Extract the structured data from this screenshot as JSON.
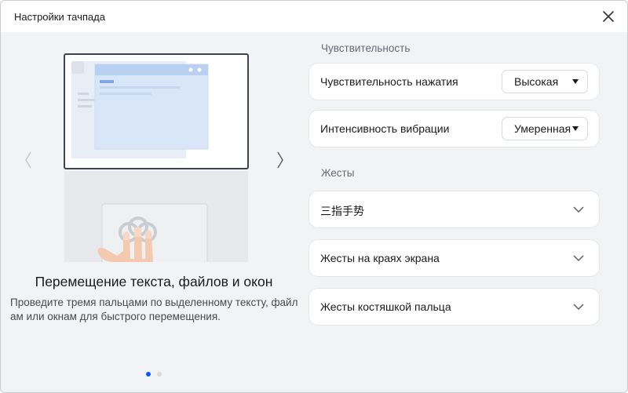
{
  "window": {
    "title": "Настройки тачпада"
  },
  "illustration": {
    "feature_title": "Перемещение текста, файлов и окон",
    "description": "Проведите тремя пальцами по выделенному тексту, файлам или окнам для быстрого перемещения.",
    "page_count": 2,
    "active_page": 1
  },
  "sensitivity": {
    "section_label": "Чувствительность",
    "press": {
      "label": "Чувствительность нажатия",
      "value": "Высокая"
    },
    "vibration": {
      "label": "Интенсивность вибрации",
      "value": "Умеренная"
    }
  },
  "gestures": {
    "section_label": "Жесты",
    "items": [
      {
        "label": "三指手势"
      },
      {
        "label": "Жесты на краях экрана"
      },
      {
        "label": "Жесты костяшкой пальца"
      }
    ]
  },
  "colors": {
    "accent": "#0a59f7",
    "background": "#f1f3f5",
    "card": "#ffffff"
  },
  "icons": {
    "close": "close-icon",
    "prev": "chevron-left-icon",
    "next": "chevron-right-icon",
    "expand": "chevron-down-icon",
    "dropdown": "caret-down-icon"
  }
}
